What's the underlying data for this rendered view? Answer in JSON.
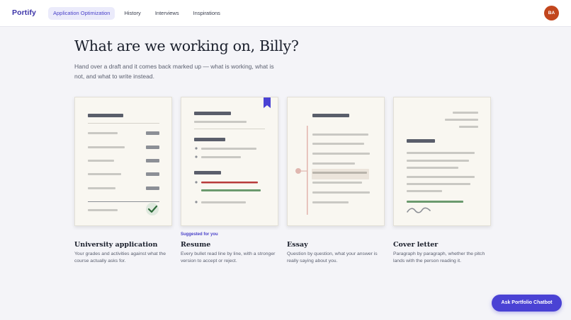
{
  "app": {
    "name": "Portify"
  },
  "nav": {
    "items": [
      {
        "label": "Application Optimization",
        "active": true
      },
      {
        "label": "History",
        "active": false
      },
      {
        "label": "Interviews",
        "active": false
      },
      {
        "label": "Inspirations",
        "active": false
      }
    ]
  },
  "user": {
    "initials": "BA",
    "avatar_color": "#c2461d"
  },
  "hero": {
    "title": "What are we working on, Billy?",
    "subtitle": "Hand over a draft and it comes back marked up — what is working, what is not, and what to write instead."
  },
  "cards": [
    {
      "title": "University application",
      "description": "Your grades and activities against what the course actually asks for.",
      "icon": "document-checklist-icon"
    },
    {
      "title": "Resume",
      "badge": "Suggested for you",
      "description": "Every bullet read line by line, with a stronger version to accept or reject.",
      "icon": "resume-bookmark-icon"
    },
    {
      "title": "Essay",
      "description": "Question by question, what your answer is really saying about you.",
      "icon": "essay-timeline-icon"
    },
    {
      "title": "Cover letter",
      "description": "Paragraph by paragraph, whether the pitch lands with the person reading it.",
      "icon": "letter-signature-icon"
    }
  ],
  "chatbot": {
    "label": "Ask Portfolio Chatbot"
  },
  "colors": {
    "accent": "#4a42d4",
    "paper": "#f9f7f1",
    "highlight_red": "#b83a3a",
    "highlight_green": "#6b9a6e"
  }
}
